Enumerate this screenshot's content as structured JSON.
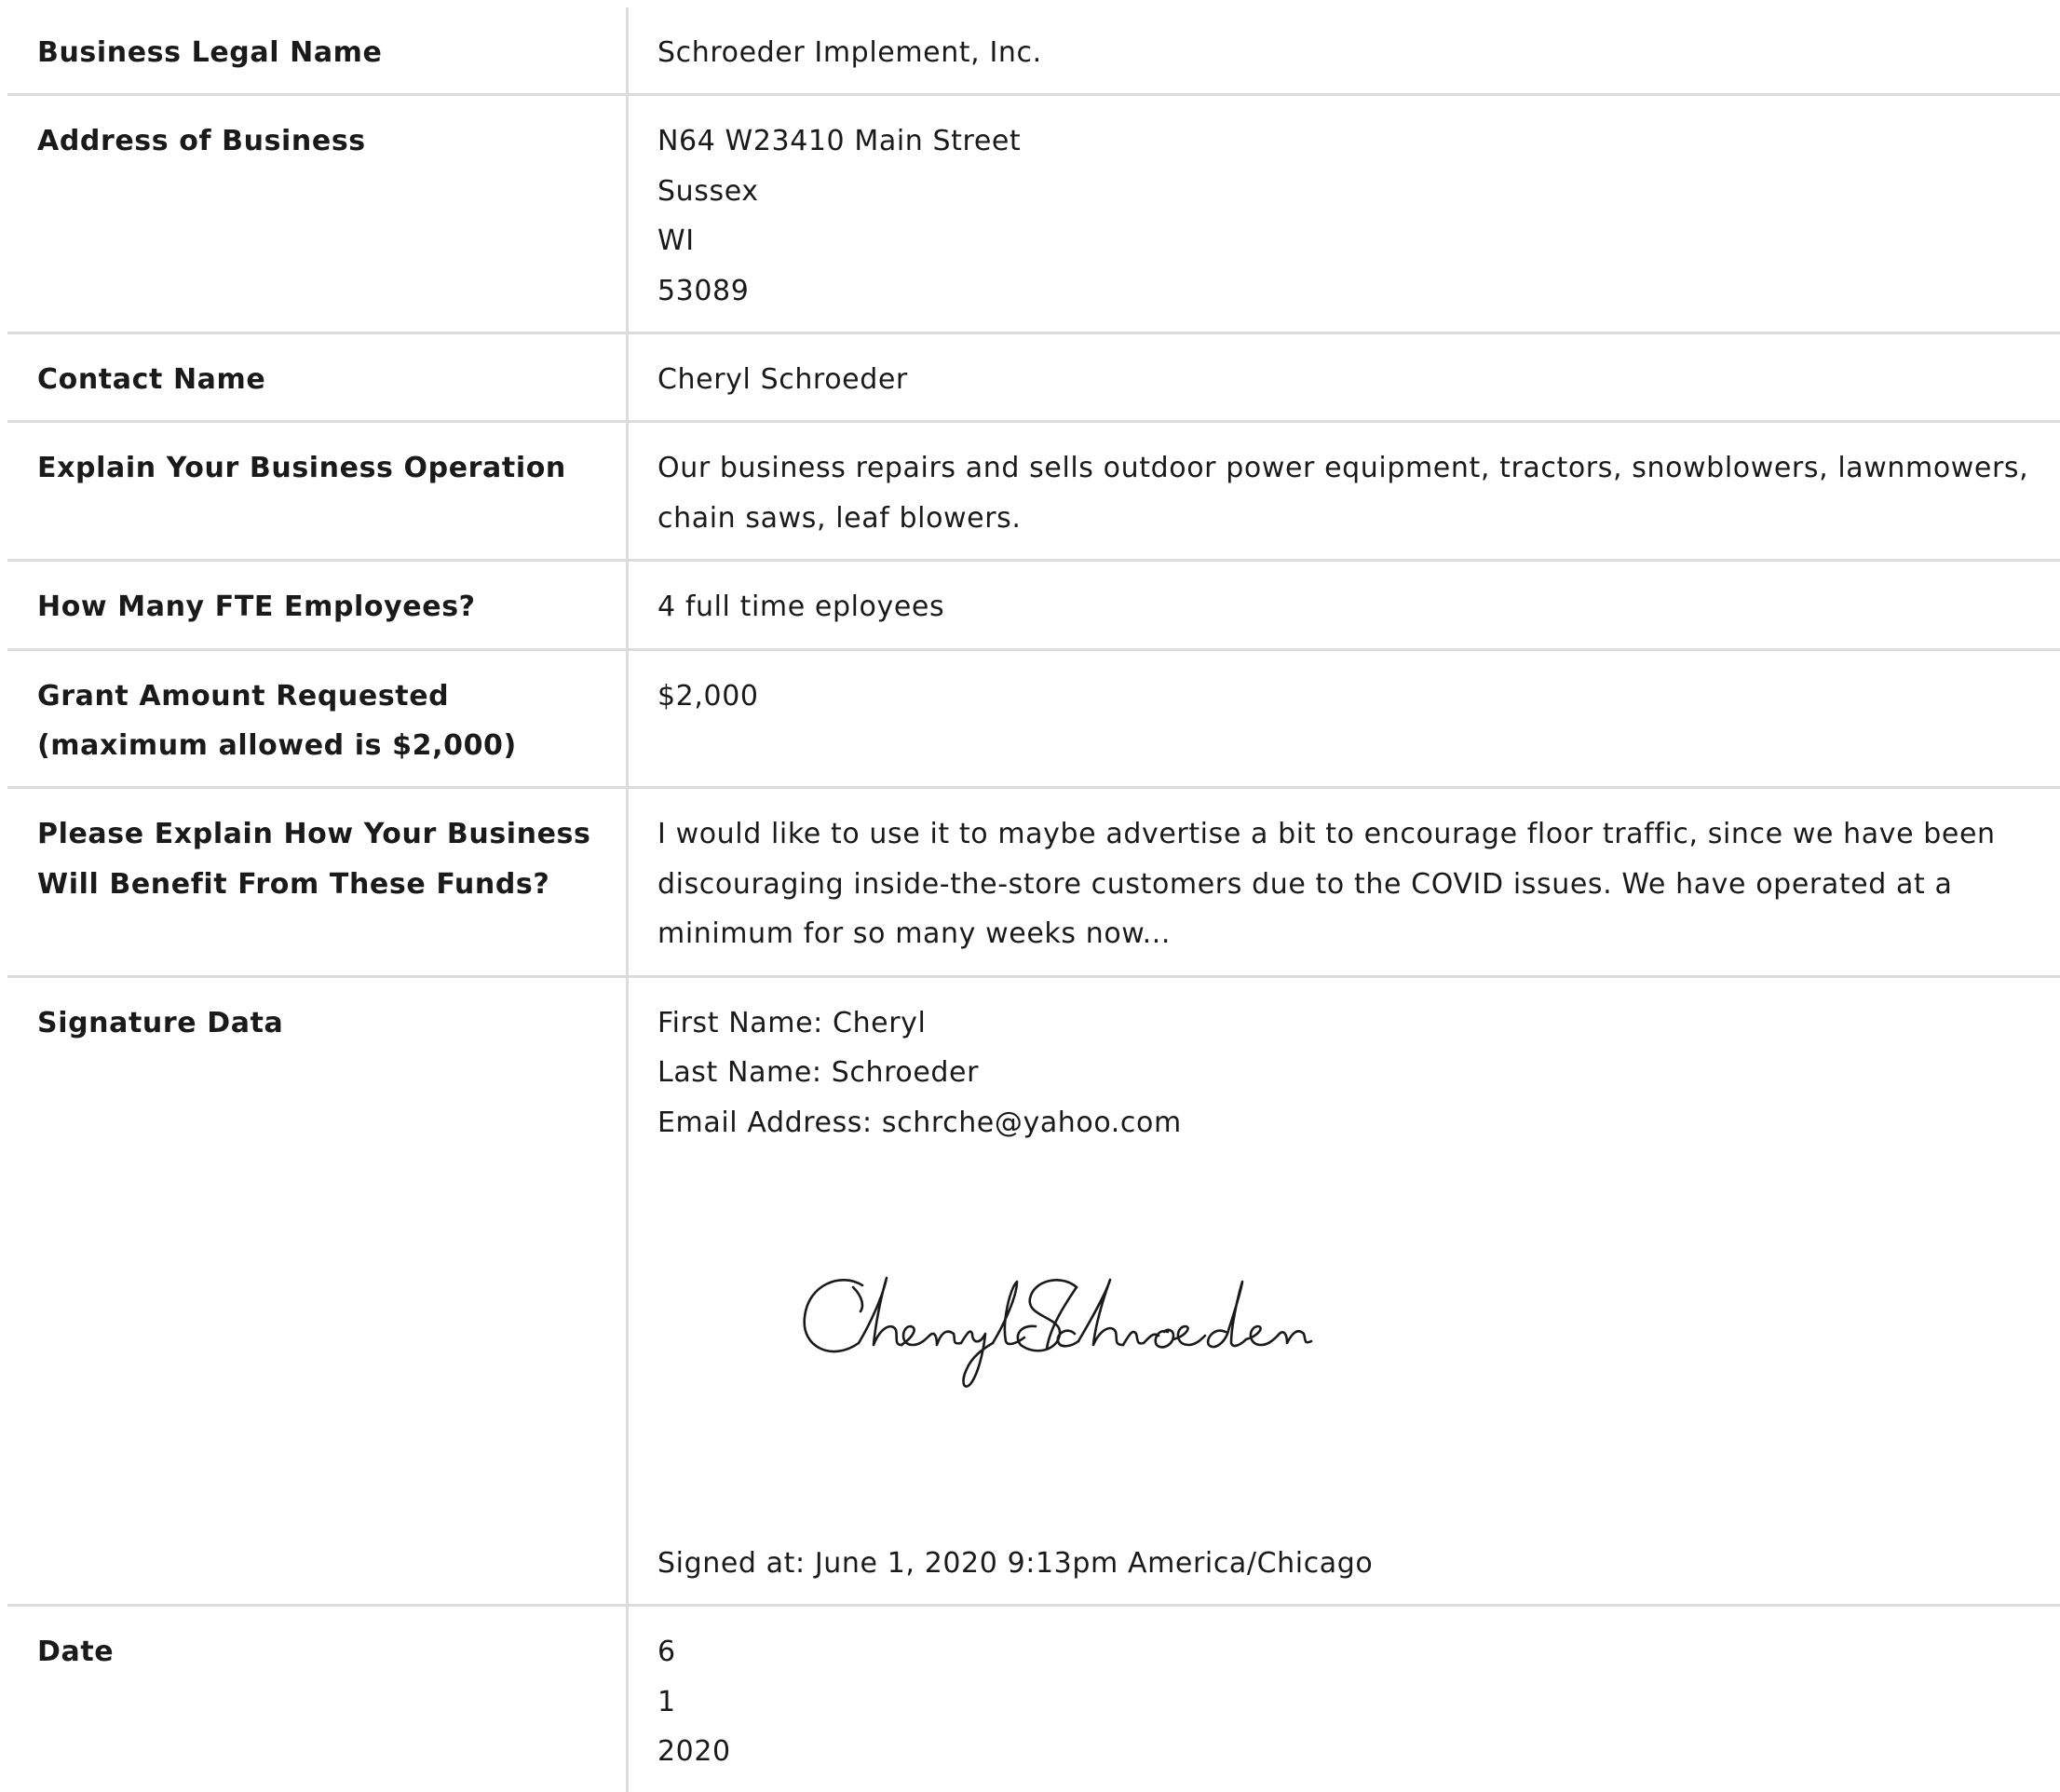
{
  "rows": [
    {
      "label": [
        "Business Legal Name"
      ],
      "value": [
        "Schroeder Implement, Inc."
      ]
    },
    {
      "label": [
        "Address of Business"
      ],
      "value": [
        "N64 W23410 Main Street",
        "Sussex",
        "WI",
        "53089"
      ]
    },
    {
      "label": [
        "Contact Name"
      ],
      "value": [
        "Cheryl Schroeder"
      ]
    },
    {
      "label": [
        "Explain Your Business Operation"
      ],
      "value": [
        "Our business repairs and sells outdoor power equipment, tractors, snowblowers, lawnmowers,",
        "chain saws, leaf blowers."
      ]
    },
    {
      "label": [
        "How Many FTE Employees?"
      ],
      "value": [
        "4 full time eployees"
      ]
    },
    {
      "label": [
        "Grant Amount Requested",
        "(maximum allowed is $2,000)"
      ],
      "value": [
        "$2,000"
      ]
    },
    {
      "label": [
        "Please Explain How Your Business",
        "Will Benefit From These Funds?"
      ],
      "value": [
        "I would like to use it to maybe advertise a bit to encourage floor traffic, since we have been",
        "discouraging inside-the-store customers due to the COVID issues. We have operated at a",
        "minimum for so many weeks now..."
      ]
    }
  ],
  "signature": {
    "label": "Signature Data",
    "first_name": "First Name: Cheryl",
    "last_name": "Last Name: Schroeder",
    "email": "Email Address: schrche@yahoo.com",
    "signature_image_text": "Cheryl Schroeder",
    "signed_at": "Signed at: June 1, 2020 9:13pm America/Chicago"
  },
  "date": {
    "label": "Date",
    "month": "6",
    "day": "1",
    "year": "2020"
  }
}
